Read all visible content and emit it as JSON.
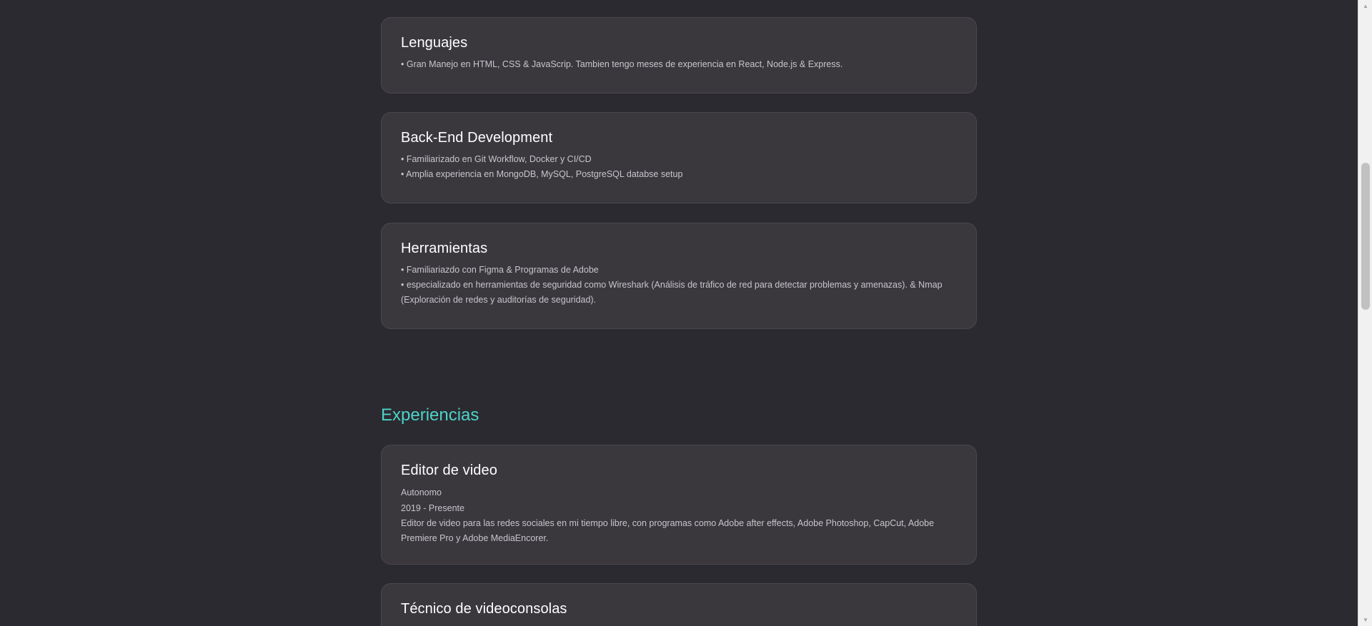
{
  "skills": [
    {
      "title": "Lenguajes",
      "lines": [
        "• Gran Manejo en HTML, CSS & JavaScrip. Tambien tengo meses de experiencia en React, Node.js & Express."
      ]
    },
    {
      "title": "Back-End Development",
      "lines": [
        "• Familiarizado en Git Workflow, Docker y CI/CD",
        "• Amplia experiencia en MongoDB, MySQL, PostgreSQL databse setup"
      ]
    },
    {
      "title": "Herramientas",
      "lines": [
        "• Familiariazdo con Figma & Programas de Adobe",
        "• especializado en herramientas de seguridad como Wireshark (Análisis de tráfico de red para detectar problemas y amenazas). & Nmap (Exploración de redes y auditorías de seguridad)."
      ]
    }
  ],
  "experiences_title": "Experiencias",
  "experiences": [
    {
      "title": "Editor de video",
      "company": "Autonomo",
      "period": "2019 - Presente",
      "description": "Editor de video para las redes sociales en mi tiempo libre, con programas como Adobe after effects, Adobe Photoshop, CapCut, Adobe Premiere Pro y Adobe MediaEncorer."
    },
    {
      "title": "Técnico de videoconsolas"
    }
  ],
  "scrollbar": {
    "up_arrow": "▲",
    "down_arrow": "▼"
  }
}
